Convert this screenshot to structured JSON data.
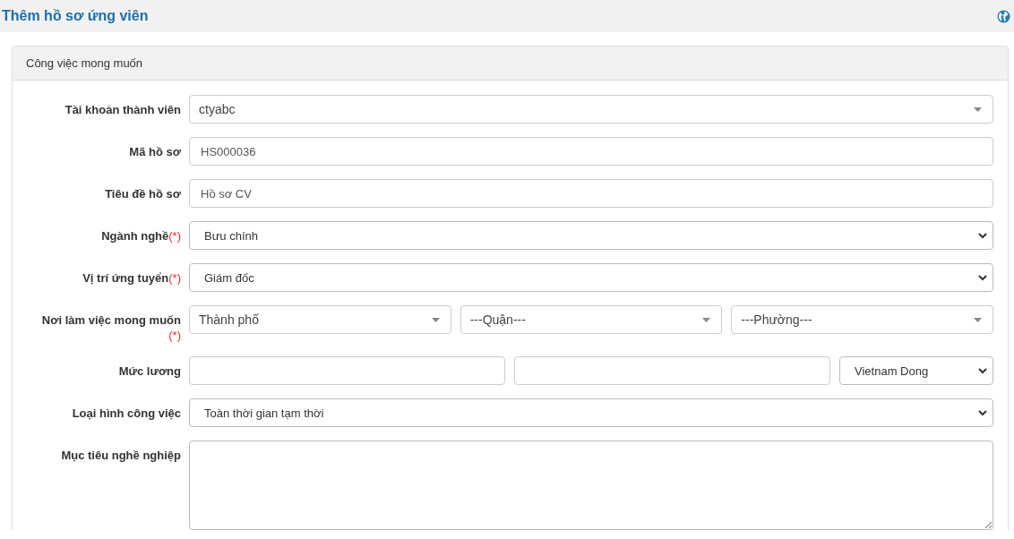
{
  "page_title": "Thêm hồ sơ ứng viên",
  "panel": {
    "title": "Công việc mong muốn",
    "fields": [
      {
        "kind": "combo",
        "label": "Tài khoản thành viên",
        "value": "ctyabc"
      },
      {
        "kind": "text",
        "label": "Mã hồ sơ",
        "value": "HS000036"
      },
      {
        "kind": "text",
        "label": "Tiêu đề hồ sơ",
        "value": "Hồ sơ CV"
      },
      {
        "kind": "select",
        "label": "Ngành nghề",
        "mark": "(*)",
        "value": "Bưu chính"
      },
      {
        "kind": "select",
        "label": "Vị trí ứng tuyển",
        "mark": "(*)",
        "value": "Giám đốc"
      },
      {
        "kind": "location",
        "label": "Nơi làm việc mong muốn",
        "mark": "(*)",
        "parts": [
          "Thành phố",
          "---Quận---",
          "---Phường---"
        ]
      },
      {
        "kind": "salary",
        "label": "Mức lương",
        "currency": "Vietnam Dong"
      },
      {
        "kind": "select",
        "label": "Loại hình công việc",
        "value": "Toàn thời gian tạm thời"
      },
      {
        "kind": "textarea",
        "label": "Mục tiêu nghề nghiệp"
      }
    ]
  }
}
